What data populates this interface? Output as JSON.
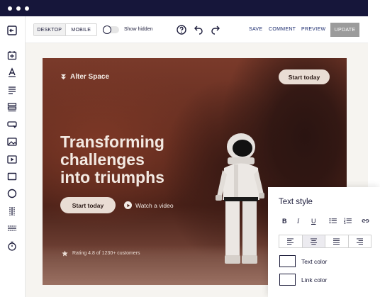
{
  "window": {
    "dots": [
      "dot",
      "dot",
      "dot"
    ]
  },
  "toolbar": {
    "device_options": [
      "DESKTOP",
      "MOBILE"
    ],
    "device_selected": "DESKTOP",
    "show_hidden_label": "Show hidden",
    "show_hidden_on": false,
    "save_label": "SAVE",
    "comment_label": "COMMENT",
    "preview_label": "PREVIEW",
    "update_label": "UPDATE",
    "icons": [
      "help-icon",
      "undo-icon",
      "redo-icon"
    ]
  },
  "sidebar": {
    "items": [
      {
        "name": "exit-icon"
      },
      {
        "name": "section-icon"
      },
      {
        "name": "text-icon"
      },
      {
        "name": "paragraph-icon"
      },
      {
        "name": "list-icon"
      },
      {
        "name": "button-icon"
      },
      {
        "name": "image-icon"
      },
      {
        "name": "video-icon"
      },
      {
        "name": "box-icon"
      },
      {
        "name": "shape-icon"
      },
      {
        "name": "columns-icon"
      },
      {
        "name": "divider-icon"
      },
      {
        "name": "timer-icon"
      }
    ]
  },
  "hero": {
    "brand_name": "Alter Space",
    "nav_cta": "Start today",
    "headline_lines": [
      "Transforming",
      "challenges",
      "into triumphs"
    ],
    "primary_cta": "Start today",
    "secondary_cta": "Watch a video",
    "rating_text": "Rating 4.8 of 1230+ customers"
  },
  "text_style_panel": {
    "title": "Text style",
    "format_buttons": [
      "B",
      "I",
      "U"
    ],
    "alignment_selected": "center",
    "text_color_label": "Text color",
    "link_color_label": "Link color"
  },
  "colors": {
    "titlebar": "#16163a",
    "accent_text": "#1b2b6e",
    "update_button": "#9b9b9b",
    "hero_pill": "#e9ddd4"
  }
}
